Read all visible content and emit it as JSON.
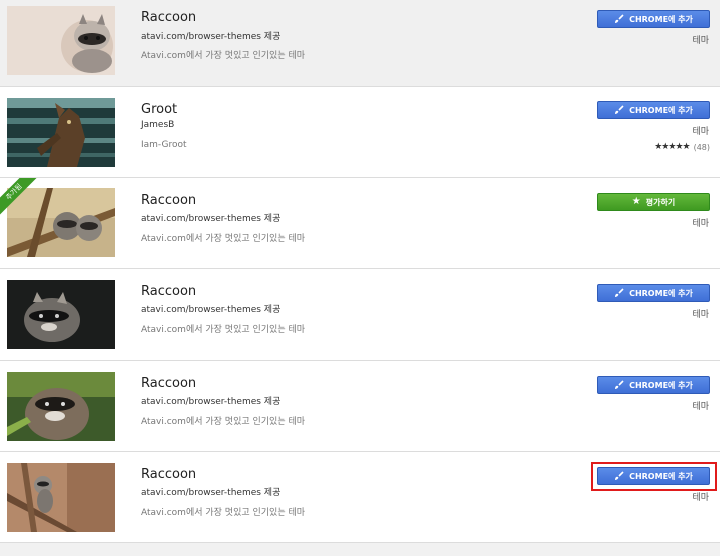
{
  "items": [
    {
      "title": "Raccoon",
      "author": "atavi.com/browser-themes 제공",
      "description": "Atavi.com에서 가장 멋있고 인기있는 테마",
      "button_label": "CHROME에 추가",
      "type_label": "테마"
    },
    {
      "title": "Groot",
      "author": "JamesB",
      "description": "Iam-Groot",
      "button_label": "CHROME에 추가",
      "type_label": "테마",
      "rating_stars": "★★★★★",
      "rating_count": "(48)",
      "rating_value": 4.5
    },
    {
      "title": "Raccoon",
      "author": "atavi.com/browser-themes 제공",
      "description": "Atavi.com에서 가장 멋있고 인기있는 테마",
      "button_label": "평가하기",
      "type_label": "테마",
      "ribbon_label": "추가됨"
    },
    {
      "title": "Raccoon",
      "author": "atavi.com/browser-themes 제공",
      "description": "Atavi.com에서 가장 멋있고 인기있는 테마",
      "button_label": "CHROME에 추가",
      "type_label": "테마"
    },
    {
      "title": "Raccoon",
      "author": "atavi.com/browser-themes 제공",
      "description": "Atavi.com에서 가장 멋있고 인기있는 테마",
      "button_label": "CHROME에 추가",
      "type_label": "테마"
    },
    {
      "title": "Raccoon",
      "author": "atavi.com/browser-themes 제공",
      "description": "Atavi.com에서 가장 멋있고 인기있는 테마",
      "button_label": "CHROME에 추가",
      "type_label": "테마"
    }
  ],
  "colors": {
    "add_button": "#4a7fe0",
    "rate_button": "#4ea52b",
    "highlight": "#e01b1b",
    "added_ribbon": "#3d9a26"
  },
  "icons": {
    "add_button_icon": "brush-icon",
    "rate_button_icon": "star-icon"
  }
}
